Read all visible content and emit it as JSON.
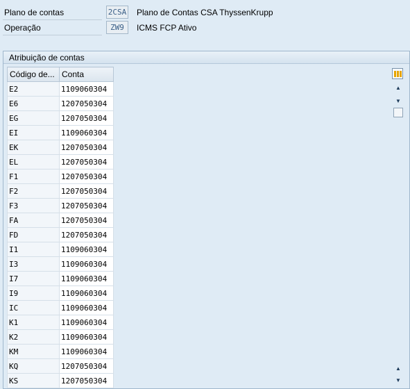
{
  "header": {
    "rows": [
      {
        "label": "Plano de contas",
        "code": "2CSA",
        "desc": "Plano de Contas CSA ThyssenKrupp"
      },
      {
        "label": "Operação",
        "code": "ZW9",
        "desc": "ICMS FCP Ativo"
      }
    ]
  },
  "group": {
    "title": "Atribuição de contas",
    "columns": [
      "Código de...",
      "Conta"
    ],
    "rows": [
      [
        "E2",
        "1109060304"
      ],
      [
        "E6",
        "1207050304"
      ],
      [
        "EG",
        "1207050304"
      ],
      [
        "EI",
        "1109060304"
      ],
      [
        "EK",
        "1207050304"
      ],
      [
        "EL",
        "1207050304"
      ],
      [
        "F1",
        "1207050304"
      ],
      [
        "F2",
        "1207050304"
      ],
      [
        "F3",
        "1207050304"
      ],
      [
        "FA",
        "1207050304"
      ],
      [
        "FD",
        "1207050304"
      ],
      [
        "I1",
        "1109060304"
      ],
      [
        "I3",
        "1109060304"
      ],
      [
        "I7",
        "1109060304"
      ],
      [
        "I9",
        "1109060304"
      ],
      [
        "IC",
        "1109060304"
      ],
      [
        "K1",
        "1109060304"
      ],
      [
        "K2",
        "1109060304"
      ],
      [
        "KM",
        "1109060304"
      ],
      [
        "KQ",
        "1207050304"
      ],
      [
        "KS",
        "1207050304"
      ]
    ]
  },
  "icons": {
    "settings": "table-settings-icon",
    "scroll_up": "▲",
    "scroll_down": "▼"
  },
  "colors": {
    "background": "#dfebf5",
    "code_text": "#3a5f87",
    "settings_accent": "#e7a500"
  }
}
